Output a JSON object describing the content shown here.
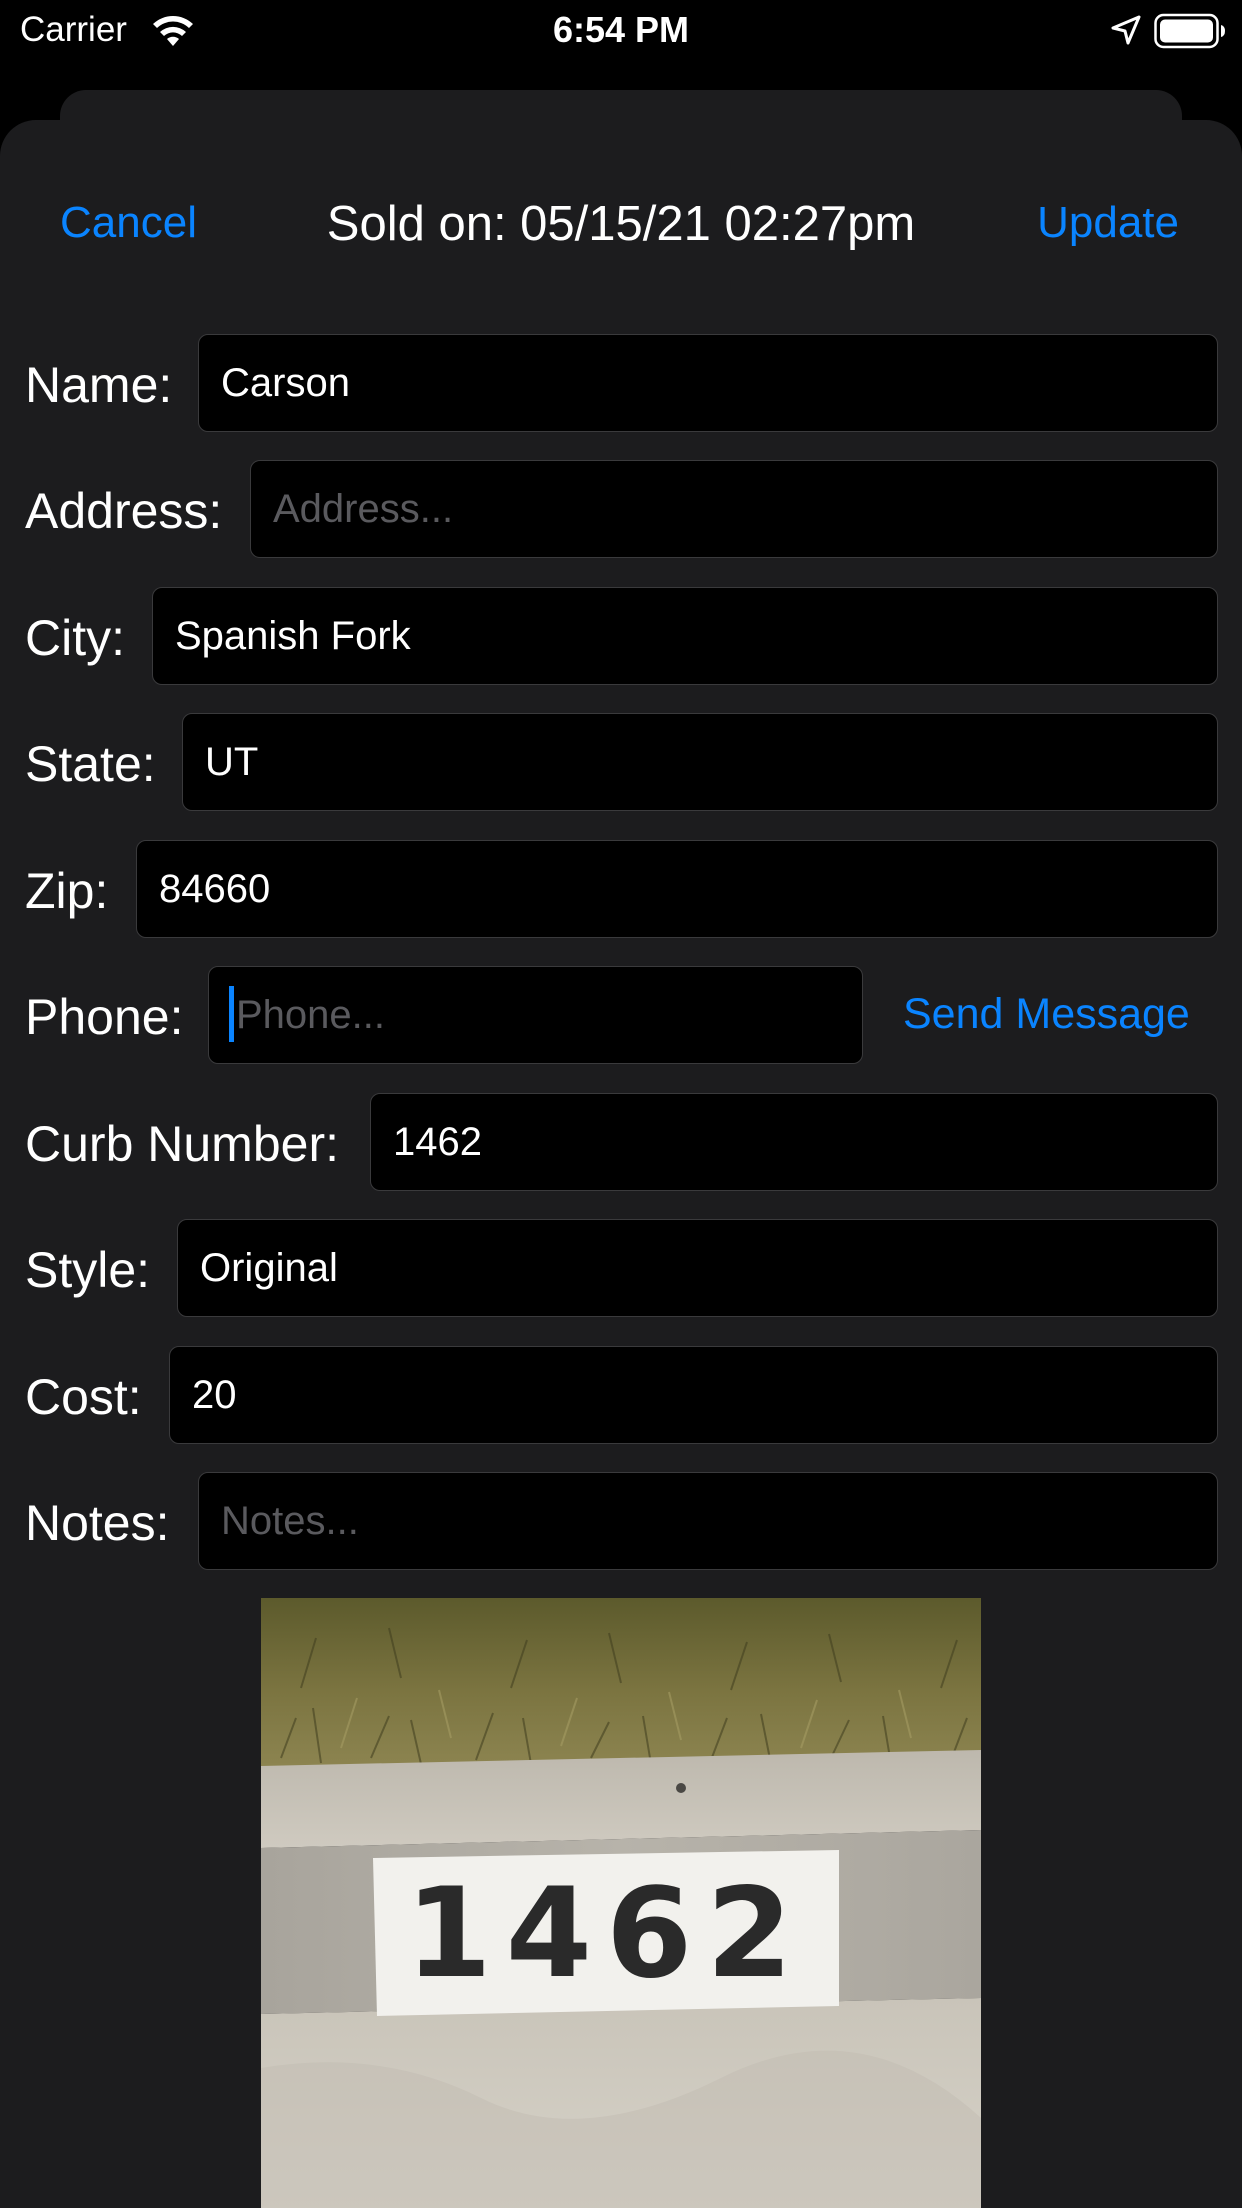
{
  "status_bar": {
    "carrier": "Carrier",
    "time": "6:54 PM"
  },
  "nav": {
    "cancel_label": "Cancel",
    "title": "Sold on: 05/15/21 02:27pm",
    "update_label": "Update"
  },
  "form": {
    "name": {
      "label": "Name:",
      "value": "Carson"
    },
    "address": {
      "label": "Address:",
      "placeholder": "Address..."
    },
    "city": {
      "label": "City:",
      "value": "Spanish Fork"
    },
    "state": {
      "label": "State:",
      "value": "UT"
    },
    "zip": {
      "label": "Zip:",
      "value": "84660"
    },
    "phone": {
      "label": "Phone:",
      "placeholder": "Phone...",
      "send_label": "Send Message"
    },
    "curb_number": {
      "label": "Curb Number:",
      "value": "1462"
    },
    "style": {
      "label": "Style:",
      "value": "Original"
    },
    "cost": {
      "label": "Cost:",
      "value": "20"
    },
    "notes": {
      "label": "Notes:",
      "placeholder": "Notes..."
    }
  },
  "photo": {
    "curb_number_painted": "1462"
  },
  "colors": {
    "accent": "#0a84ff",
    "sheet_background": "#1c1c1e",
    "field_background": "#000000"
  }
}
